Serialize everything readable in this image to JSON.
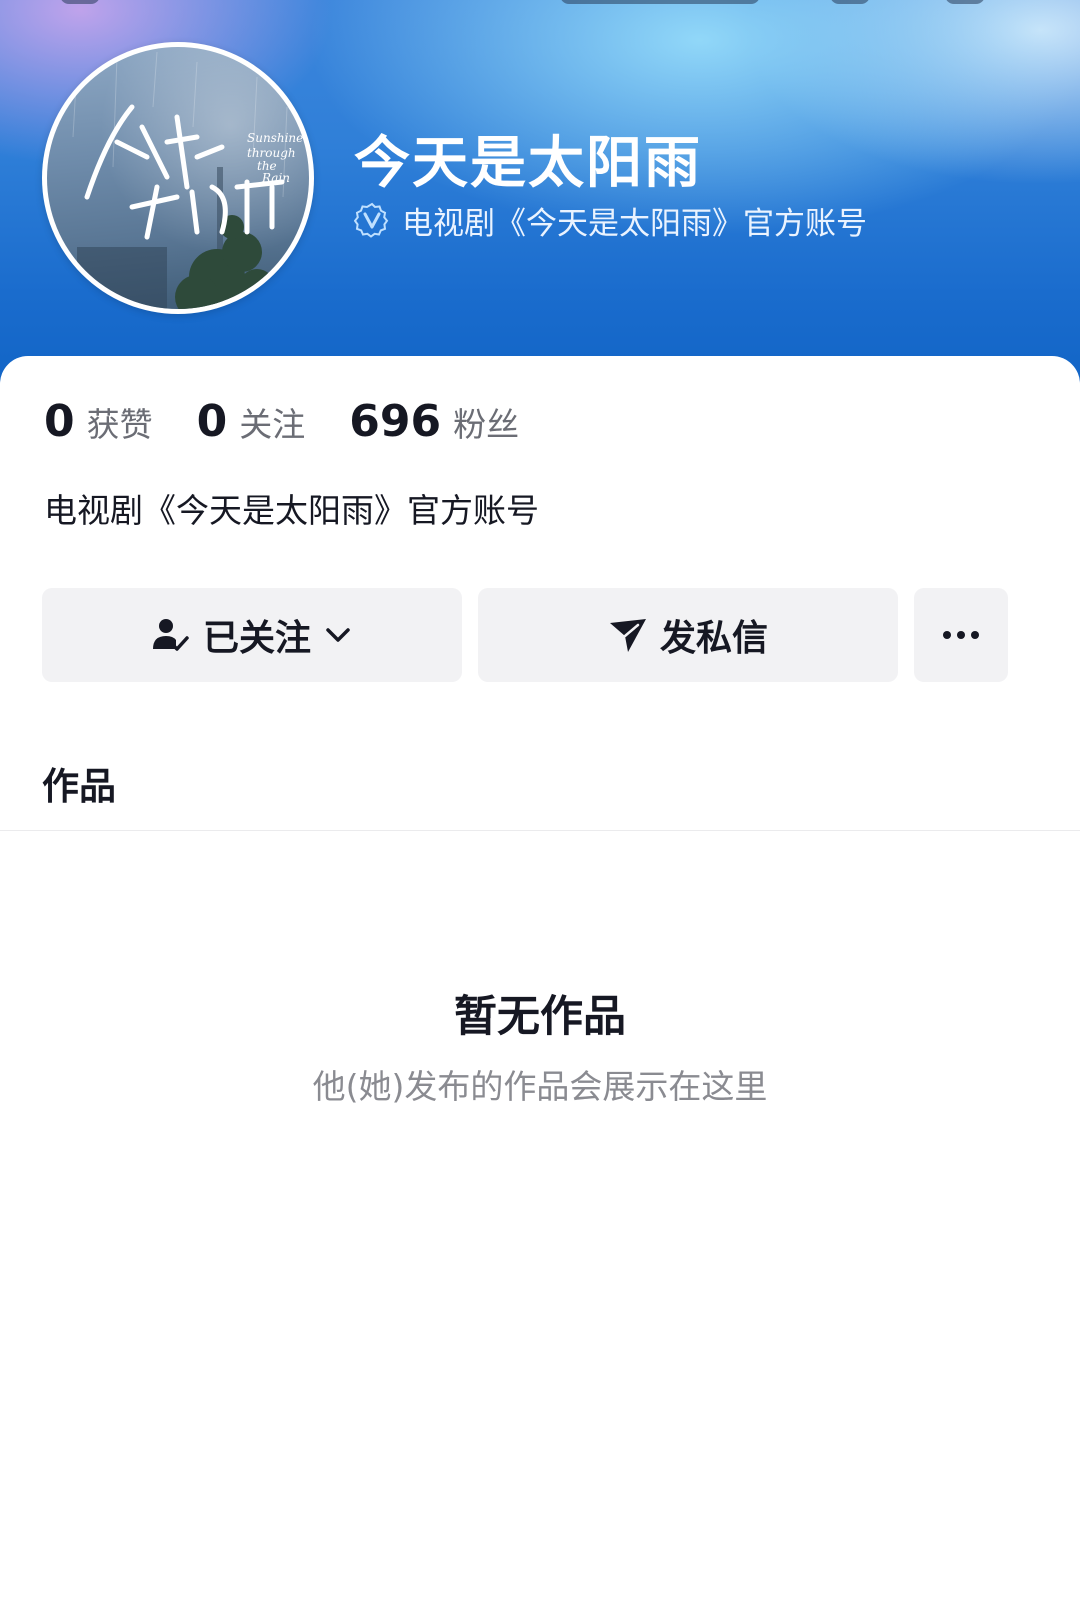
{
  "profile": {
    "display_name": "今天是太阳雨",
    "verification_text": "电视剧《今天是太阳雨》官方账号",
    "avatar_art_lines": [
      "今天是",
      "太阳雨"
    ],
    "avatar_art_english": [
      "Sunshine",
      "through",
      "the",
      "Rain"
    ]
  },
  "stats": [
    {
      "value": "0",
      "label": "获赞"
    },
    {
      "value": "0",
      "label": "关注"
    },
    {
      "value": "696",
      "label": "粉丝"
    }
  ],
  "bio": "电视剧《今天是太阳雨》官方账号",
  "actions": {
    "follow_label": "已关注",
    "message_label": "发私信"
  },
  "tabs": {
    "works_label": "作品"
  },
  "empty_state": {
    "title": "暂无作品",
    "subtitle": "他(她)发布的作品会展示在这里"
  },
  "colors": {
    "banner_blue": "#1a6ccd",
    "button_bg": "#f2f2f4",
    "text_primary": "#161823",
    "text_secondary": "#8a8b91"
  },
  "icons": {
    "verified": "verified-badge-icon",
    "followed": "user-check-icon",
    "dropdown": "chevron-down-icon",
    "message": "send-icon",
    "more": "more-dots-icon"
  }
}
